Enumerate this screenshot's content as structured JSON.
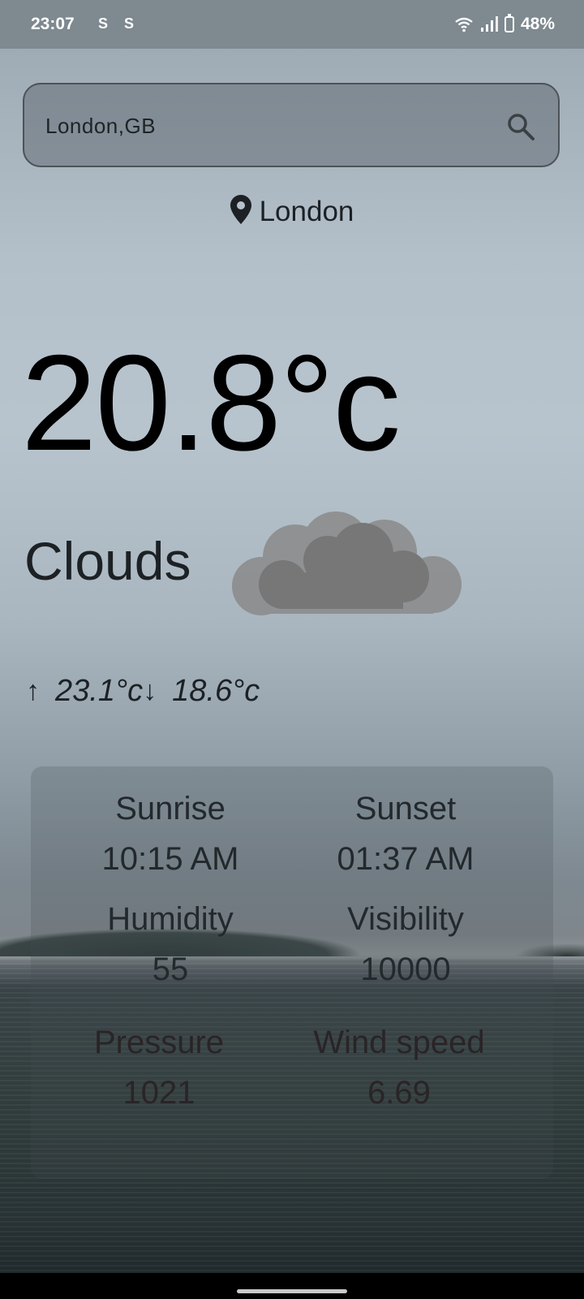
{
  "status_bar": {
    "time": "23:07",
    "notification_icons": [
      "s-icon",
      "s-icon"
    ],
    "battery": "48%"
  },
  "search": {
    "value": "London,GB",
    "placeholder": ""
  },
  "location": {
    "city": "London"
  },
  "weather": {
    "temperature": "20.8°c",
    "condition": "Clouds",
    "max_temp": "23.1°c",
    "min_temp": "18.6°c"
  },
  "details": {
    "sunrise_label": "Sunrise",
    "sunrise_value": "10:15 AM",
    "sunset_label": "Sunset",
    "sunset_value": "01:37 AM",
    "humidity_label": "Humidity",
    "humidity_value": "55",
    "visibility_label": "Visibility",
    "visibility_value": "10000",
    "pressure_label": "Pressure",
    "pressure_value": "1021",
    "wind_label": "Wind speed",
    "wind_value": "6.69"
  },
  "colors": {
    "status_bar": "#7e8990",
    "temperature": "#000000",
    "cloud": "#7a7a7a"
  }
}
